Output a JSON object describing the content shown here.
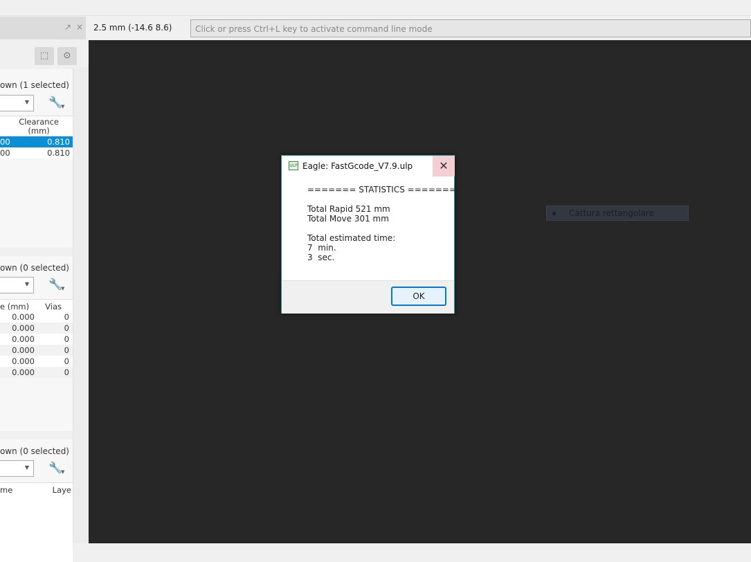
{
  "header": {
    "coordinate": "2.5 mm (-14.6 8.6)",
    "command_placeholder": "Click or press Ctrl+L key to activate command line mode",
    "undock": "↗",
    "close": "×"
  },
  "sections": [
    {
      "title": "hown (1 selected)",
      "columns": [
        "Clearance\n(mm)"
      ],
      "rows": [
        {
          "c0": "00",
          "c1": "0.810",
          "selected": true
        },
        {
          "c0": "00",
          "c1": "0.810",
          "selected": false
        }
      ]
    },
    {
      "title": "hown (0 selected)",
      "columns": [
        "e (mm)",
        "Vias"
      ],
      "rows": [
        [
          "0.000",
          "0"
        ],
        [
          "0.000",
          "0"
        ],
        [
          "0.000",
          "0"
        ],
        [
          "0.000",
          "0"
        ],
        [
          "0.000",
          "0"
        ],
        [
          "0.000",
          "0"
        ]
      ]
    },
    {
      "title": "hown (0 selected)",
      "columns": [
        "me",
        "Laye"
      ]
    }
  ],
  "dialog": {
    "title": "Eagle: FastGcode_V7.9.ulp",
    "icon": "ulp-icon",
    "icon_text": "ULP",
    "close": "✕",
    "body": "======= STATISTICS =======\n\nTotal Rapid 521 mm\nTotal Move 301 mm\n\nTotal estimated time:\n7  min.\n3  sec.",
    "ok": "OK"
  },
  "tooltip": {
    "label": "Cattura rettangolare"
  },
  "colors": {
    "selection": "#0a8ed6",
    "canvas": "#272727",
    "dialog_border": "#1f9a9a"
  }
}
